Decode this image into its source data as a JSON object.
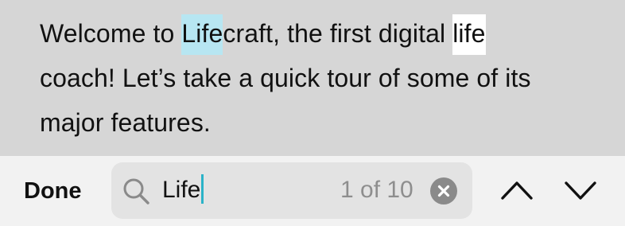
{
  "document": {
    "lines": [
      {
        "before": "Welcome to ",
        "current_match": "Life",
        "middle": "craft, the first digital ",
        "other_match": "life",
        "after": ""
      },
      {
        "text": "coach! Let’s take a quick tour of some of its"
      },
      {
        "text": "major features."
      }
    ]
  },
  "find_bar": {
    "done_label": "Done",
    "query": "Life",
    "match_count": "1 of 10",
    "icons": {
      "search": "magnifying-glass",
      "clear": "x-circle",
      "previous": "chevron-up",
      "next": "chevron-down"
    }
  },
  "colors": {
    "current_match_highlight": "#b7e6f2",
    "other_match_highlight": "#ffffff",
    "caret": "#2bb3c8",
    "dimmed_background": "#d6d6d6",
    "find_bar_background": "#f2f2f2"
  }
}
